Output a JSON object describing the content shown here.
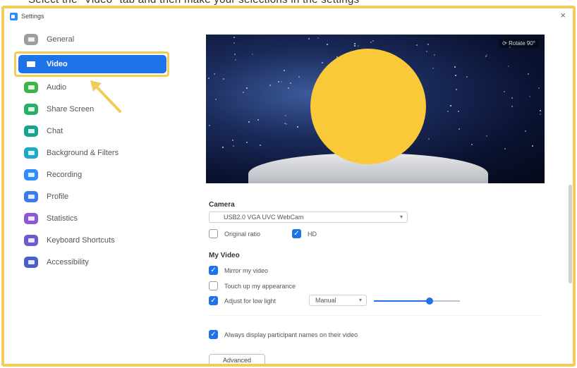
{
  "window": {
    "title": "Settings",
    "close_glyph": "×"
  },
  "top_caption": "Select the \"Video\" tab and then make your selections in the settings",
  "sidebar": {
    "items": [
      {
        "label": "General",
        "icon": "gear-icon",
        "color": "#9e9e9e",
        "active": false
      },
      {
        "label": "Video",
        "icon": "video-camera-icon",
        "color": "#1f73e8",
        "active": true
      },
      {
        "label": "Audio",
        "icon": "headphones-icon",
        "color": "#3bb54a",
        "active": false
      },
      {
        "label": "Share Screen",
        "icon": "share-screen-icon",
        "color": "#27b066",
        "active": false
      },
      {
        "label": "Chat",
        "icon": "chat-icon",
        "color": "#16a390",
        "active": false
      },
      {
        "label": "Background & Filters",
        "icon": "background-icon",
        "color": "#1fa9c9",
        "active": false
      },
      {
        "label": "Recording",
        "icon": "recording-icon",
        "color": "#2d8cff",
        "active": false
      },
      {
        "label": "Profile",
        "icon": "profile-icon",
        "color": "#3a7bf0",
        "active": false
      },
      {
        "label": "Statistics",
        "icon": "statistics-icon",
        "color": "#8b57d6",
        "active": false
      },
      {
        "label": "Keyboard Shortcuts",
        "icon": "keyboard-icon",
        "color": "#6b5bd1",
        "active": false
      },
      {
        "label": "Accessibility",
        "icon": "accessibility-icon",
        "color": "#4a5fc9",
        "active": false
      }
    ]
  },
  "preview": {
    "rotate_label": "⟳ Rotate 90°"
  },
  "camera": {
    "section_label": "Camera",
    "device": "USB2.0 VGA UVC WebCam",
    "original_ratio": {
      "label": "Original ratio",
      "checked": false
    },
    "hd": {
      "label": "HD",
      "checked": true
    }
  },
  "my_video": {
    "section_label": "My Video",
    "mirror": {
      "label": "Mirror my video",
      "checked": true
    },
    "touch_up": {
      "label": "Touch up my appearance",
      "checked": false
    },
    "low_light": {
      "label": "Adjust for low light",
      "checked": true,
      "mode": "Manual",
      "level": 0.65
    },
    "always_names": {
      "label": "Always display participant names on their video",
      "checked": true
    }
  },
  "advanced_label": "Advanced",
  "colors": {
    "accent": "#1f73e8",
    "highlight": "#f2cc5a"
  }
}
